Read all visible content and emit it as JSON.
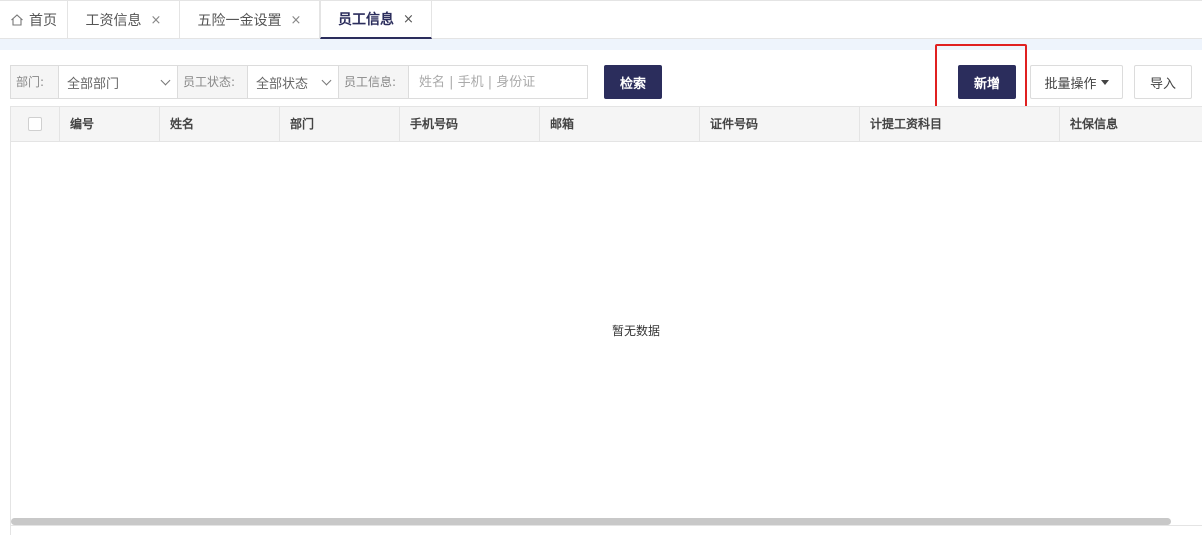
{
  "tabs": [
    {
      "label": "首页",
      "icon": "home-icon",
      "closable": false
    },
    {
      "label": "工资信息",
      "closable": true
    },
    {
      "label": "五险一金设置",
      "closable": true
    },
    {
      "label": "员工信息",
      "closable": true,
      "active": true
    }
  ],
  "tab_close_glyph": "×",
  "filters": {
    "department": {
      "label": "部门:",
      "value": "全部部门"
    },
    "status": {
      "label": "员工状态:",
      "value": "全部状态"
    },
    "info": {
      "label": "员工信息:",
      "placeholder": "姓名 | 手机 | 身份证",
      "value": ""
    }
  },
  "toolbar": {
    "search_label": "检索",
    "add_label": "新增",
    "batch_label": "批量操作",
    "import_label": "导入"
  },
  "table": {
    "columns": [
      "编号",
      "姓名",
      "部门",
      "手机号码",
      "邮箱",
      "证件号码",
      "计提工资科目",
      "社保信息"
    ],
    "rows": [],
    "empty_text": "暂无数据"
  },
  "colors": {
    "primary": "#2b2d5c",
    "highlight": "#e02020",
    "strip": "#eef4fc"
  }
}
